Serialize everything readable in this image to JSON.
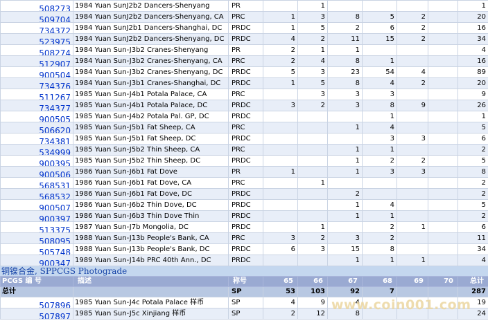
{
  "rows": [
    {
      "id": "508273",
      "desc": "1984 Yuan SunJ2b2 Dancers-Shenyang",
      "type": "PR",
      "g65": "",
      "g66": "1",
      "g67": "",
      "g68": "",
      "g69": "",
      "g70": "",
      "total": "1"
    },
    {
      "id": "509704",
      "desc": "1984 Yuan SunJ2b2 Dancers-Shenyang, CA",
      "type": "PRC",
      "g65": "1",
      "g66": "3",
      "g67": "8",
      "g68": "5",
      "g69": "2",
      "g70": "",
      "total": "20"
    },
    {
      "id": "734372",
      "desc": "1984 Yuan SunJ2b1 Dancers-Shanghai, DC",
      "type": "PRDC",
      "g65": "1",
      "g66": "5",
      "g67": "2",
      "g68": "6",
      "g69": "2",
      "g70": "",
      "total": "16"
    },
    {
      "id": "523975",
      "desc": "1984 Yuan SunJ2b2 Dancers-Shenyang, DC",
      "type": "PRDC",
      "g65": "4",
      "g66": "2",
      "g67": "11",
      "g68": "15",
      "g69": "2",
      "g70": "",
      "total": "34"
    },
    {
      "id": "508274",
      "desc": "1984 Yuan Sun-J3b2 Cranes-Shenyang",
      "type": "PR",
      "g65": "2",
      "g66": "1",
      "g67": "1",
      "g68": "",
      "g69": "",
      "g70": "",
      "total": "4"
    },
    {
      "id": "512907",
      "desc": "1984 Yuan Sun-J3b2 Cranes-Shenyang, CA",
      "type": "PRC",
      "g65": "2",
      "g66": "4",
      "g67": "8",
      "g68": "1",
      "g69": "",
      "g70": "",
      "total": "16"
    },
    {
      "id": "900504",
      "desc": "1984 Yuan Sun-J3b2 Cranes-Shenyang, DC",
      "type": "PRDC",
      "g65": "5",
      "g66": "3",
      "g67": "23",
      "g68": "54",
      "g69": "4",
      "g70": "",
      "total": "89"
    },
    {
      "id": "734376",
      "desc": "1984 Yuan Sun-J3b1 Cranes-Shanghai, DC",
      "type": "PRDC",
      "g65": "1",
      "g66": "5",
      "g67": "8",
      "g68": "4",
      "g69": "2",
      "g70": "",
      "total": "20"
    },
    {
      "id": "511267",
      "desc": "1985 Yuan Sun-J4b1 Potala Palace, CA",
      "type": "PRC",
      "g65": "",
      "g66": "3",
      "g67": "3",
      "g68": "3",
      "g69": "",
      "g70": "",
      "total": "9"
    },
    {
      "id": "734377",
      "desc": "1985 Yuan Sun-J4b1 Potala Palace, DC",
      "type": "PRDC",
      "g65": "3",
      "g66": "2",
      "g67": "3",
      "g68": "8",
      "g69": "9",
      "g70": "",
      "total": "26"
    },
    {
      "id": "900505",
      "desc": "1985 Yuan Sun-J4b2 Potala Pal. GP, DC",
      "type": "PRDC",
      "g65": "",
      "g66": "",
      "g67": "",
      "g68": "1",
      "g69": "",
      "g70": "",
      "total": "1"
    },
    {
      "id": "506620",
      "desc": "1985 Yuan Sun-J5b1 Fat Sheep, CA",
      "type": "PRC",
      "g65": "",
      "g66": "",
      "g67": "1",
      "g68": "4",
      "g69": "",
      "g70": "",
      "total": "5"
    },
    {
      "id": "734381",
      "desc": "1985 Yuan Sun-J5b1 Fat Sheep, DC",
      "type": "PRDC",
      "g65": "",
      "g66": "",
      "g67": "",
      "g68": "3",
      "g69": "3",
      "g70": "",
      "total": "6"
    },
    {
      "id": "534999",
      "desc": "1985 Yuan Sun-J5b2 Thin Sheep, CA",
      "type": "PRC",
      "g65": "",
      "g66": "",
      "g67": "1",
      "g68": "1",
      "g69": "",
      "g70": "",
      "total": "2"
    },
    {
      "id": "900395",
      "desc": "1985 Yuan Sun-J5b2 Thin Sheep, DC",
      "type": "PRDC",
      "g65": "",
      "g66": "",
      "g67": "1",
      "g68": "2",
      "g69": "2",
      "g70": "",
      "total": "5"
    },
    {
      "id": "900506",
      "desc": "1986 Yuan Sun-J6b1 Fat Dove",
      "type": "PR",
      "g65": "1",
      "g66": "",
      "g67": "1",
      "g68": "3",
      "g69": "3",
      "g70": "",
      "total": "8"
    },
    {
      "id": "568531",
      "desc": "1986 Yuan Sun-J6b1 Fat Dove, CA",
      "type": "PRC",
      "g65": "",
      "g66": "1",
      "g67": "",
      "g68": "",
      "g69": "",
      "g70": "",
      "total": "2"
    },
    {
      "id": "568532",
      "desc": "1986 Yuan Sun-J6b1 Fat Dove, DC",
      "type": "PRDC",
      "g65": "",
      "g66": "",
      "g67": "2",
      "g68": "",
      "g69": "",
      "g70": "",
      "total": "2"
    },
    {
      "id": "900507",
      "desc": "1986 Yuan Sun-J6b2 Thin Dove, DC",
      "type": "PRDC",
      "g65": "",
      "g66": "",
      "g67": "1",
      "g68": "4",
      "g69": "",
      "g70": "",
      "total": "5"
    },
    {
      "id": "900397",
      "desc": "1986 Yuan Sun-J6b3 Thin Dove Thin",
      "type": "PRDC",
      "g65": "",
      "g66": "",
      "g67": "1",
      "g68": "1",
      "g69": "",
      "g70": "",
      "total": "2"
    },
    {
      "id": "513375",
      "desc": "1987 Yuan Sun-J7b Mongolia, DC",
      "type": "PRDC",
      "g65": "",
      "g66": "1",
      "g67": "",
      "g68": "2",
      "g69": "1",
      "g70": "",
      "total": "6"
    },
    {
      "id": "508095",
      "desc": "1988 Yuan Sun-J13b People's Bank, CA",
      "type": "PRC",
      "g65": "3",
      "g66": "2",
      "g67": "3",
      "g68": "2",
      "g69": "",
      "g70": "",
      "total": "11"
    },
    {
      "id": "505748",
      "desc": "1988 Yuan Sun-J13b People's Bank, DC",
      "type": "PRDC",
      "g65": "6",
      "g66": "3",
      "g67": "15",
      "g68": "8",
      "g69": "",
      "g70": "",
      "total": "34"
    },
    {
      "id": "900347",
      "desc": "1989 Yuan Sun-J14b PRC 40th Ann., DC",
      "type": "PRDC",
      "g65": "",
      "g66": "",
      "g67": "1",
      "g68": "1",
      "g69": "1",
      "g70": "",
      "total": "4"
    }
  ],
  "section_title": "铜镍合金, SPPCGS Photograde",
  "header": {
    "id": "PCGS 编 号",
    "desc": "描述",
    "type": "称号",
    "g65": "65",
    "g66": "66",
    "g67": "67",
    "g68": "68",
    "g69": "69",
    "g70": "70",
    "total": "总计"
  },
  "summary": {
    "label": "总计",
    "type": "SP",
    "g65": "53",
    "g66": "103",
    "g67": "92",
    "g68": "7",
    "g69": "",
    "g70": "",
    "total": "287"
  },
  "sp_rows": [
    {
      "id": "507896",
      "desc": "1985 Yuan Sun-J4c Potala Palace 样币",
      "type": "SP",
      "g65": "4",
      "g66": "9",
      "g67": "4",
      "g68": "",
      "g69": "",
      "g70": "",
      "total": "19"
    },
    {
      "id": "507897",
      "desc": "1985 Yuan Sun-J5c Xinjiang 样币",
      "type": "SP",
      "g65": "2",
      "g66": "12",
      "g67": "8",
      "g68": "",
      "g69": "",
      "g70": "",
      "total": "24"
    }
  ],
  "watermark": "www.coin001.com",
  "colors": {
    "link": "#0033cc",
    "header_bg": "#9aaad2",
    "section_bg": "#c4d7ef",
    "stripe": "#e8eef8"
  }
}
